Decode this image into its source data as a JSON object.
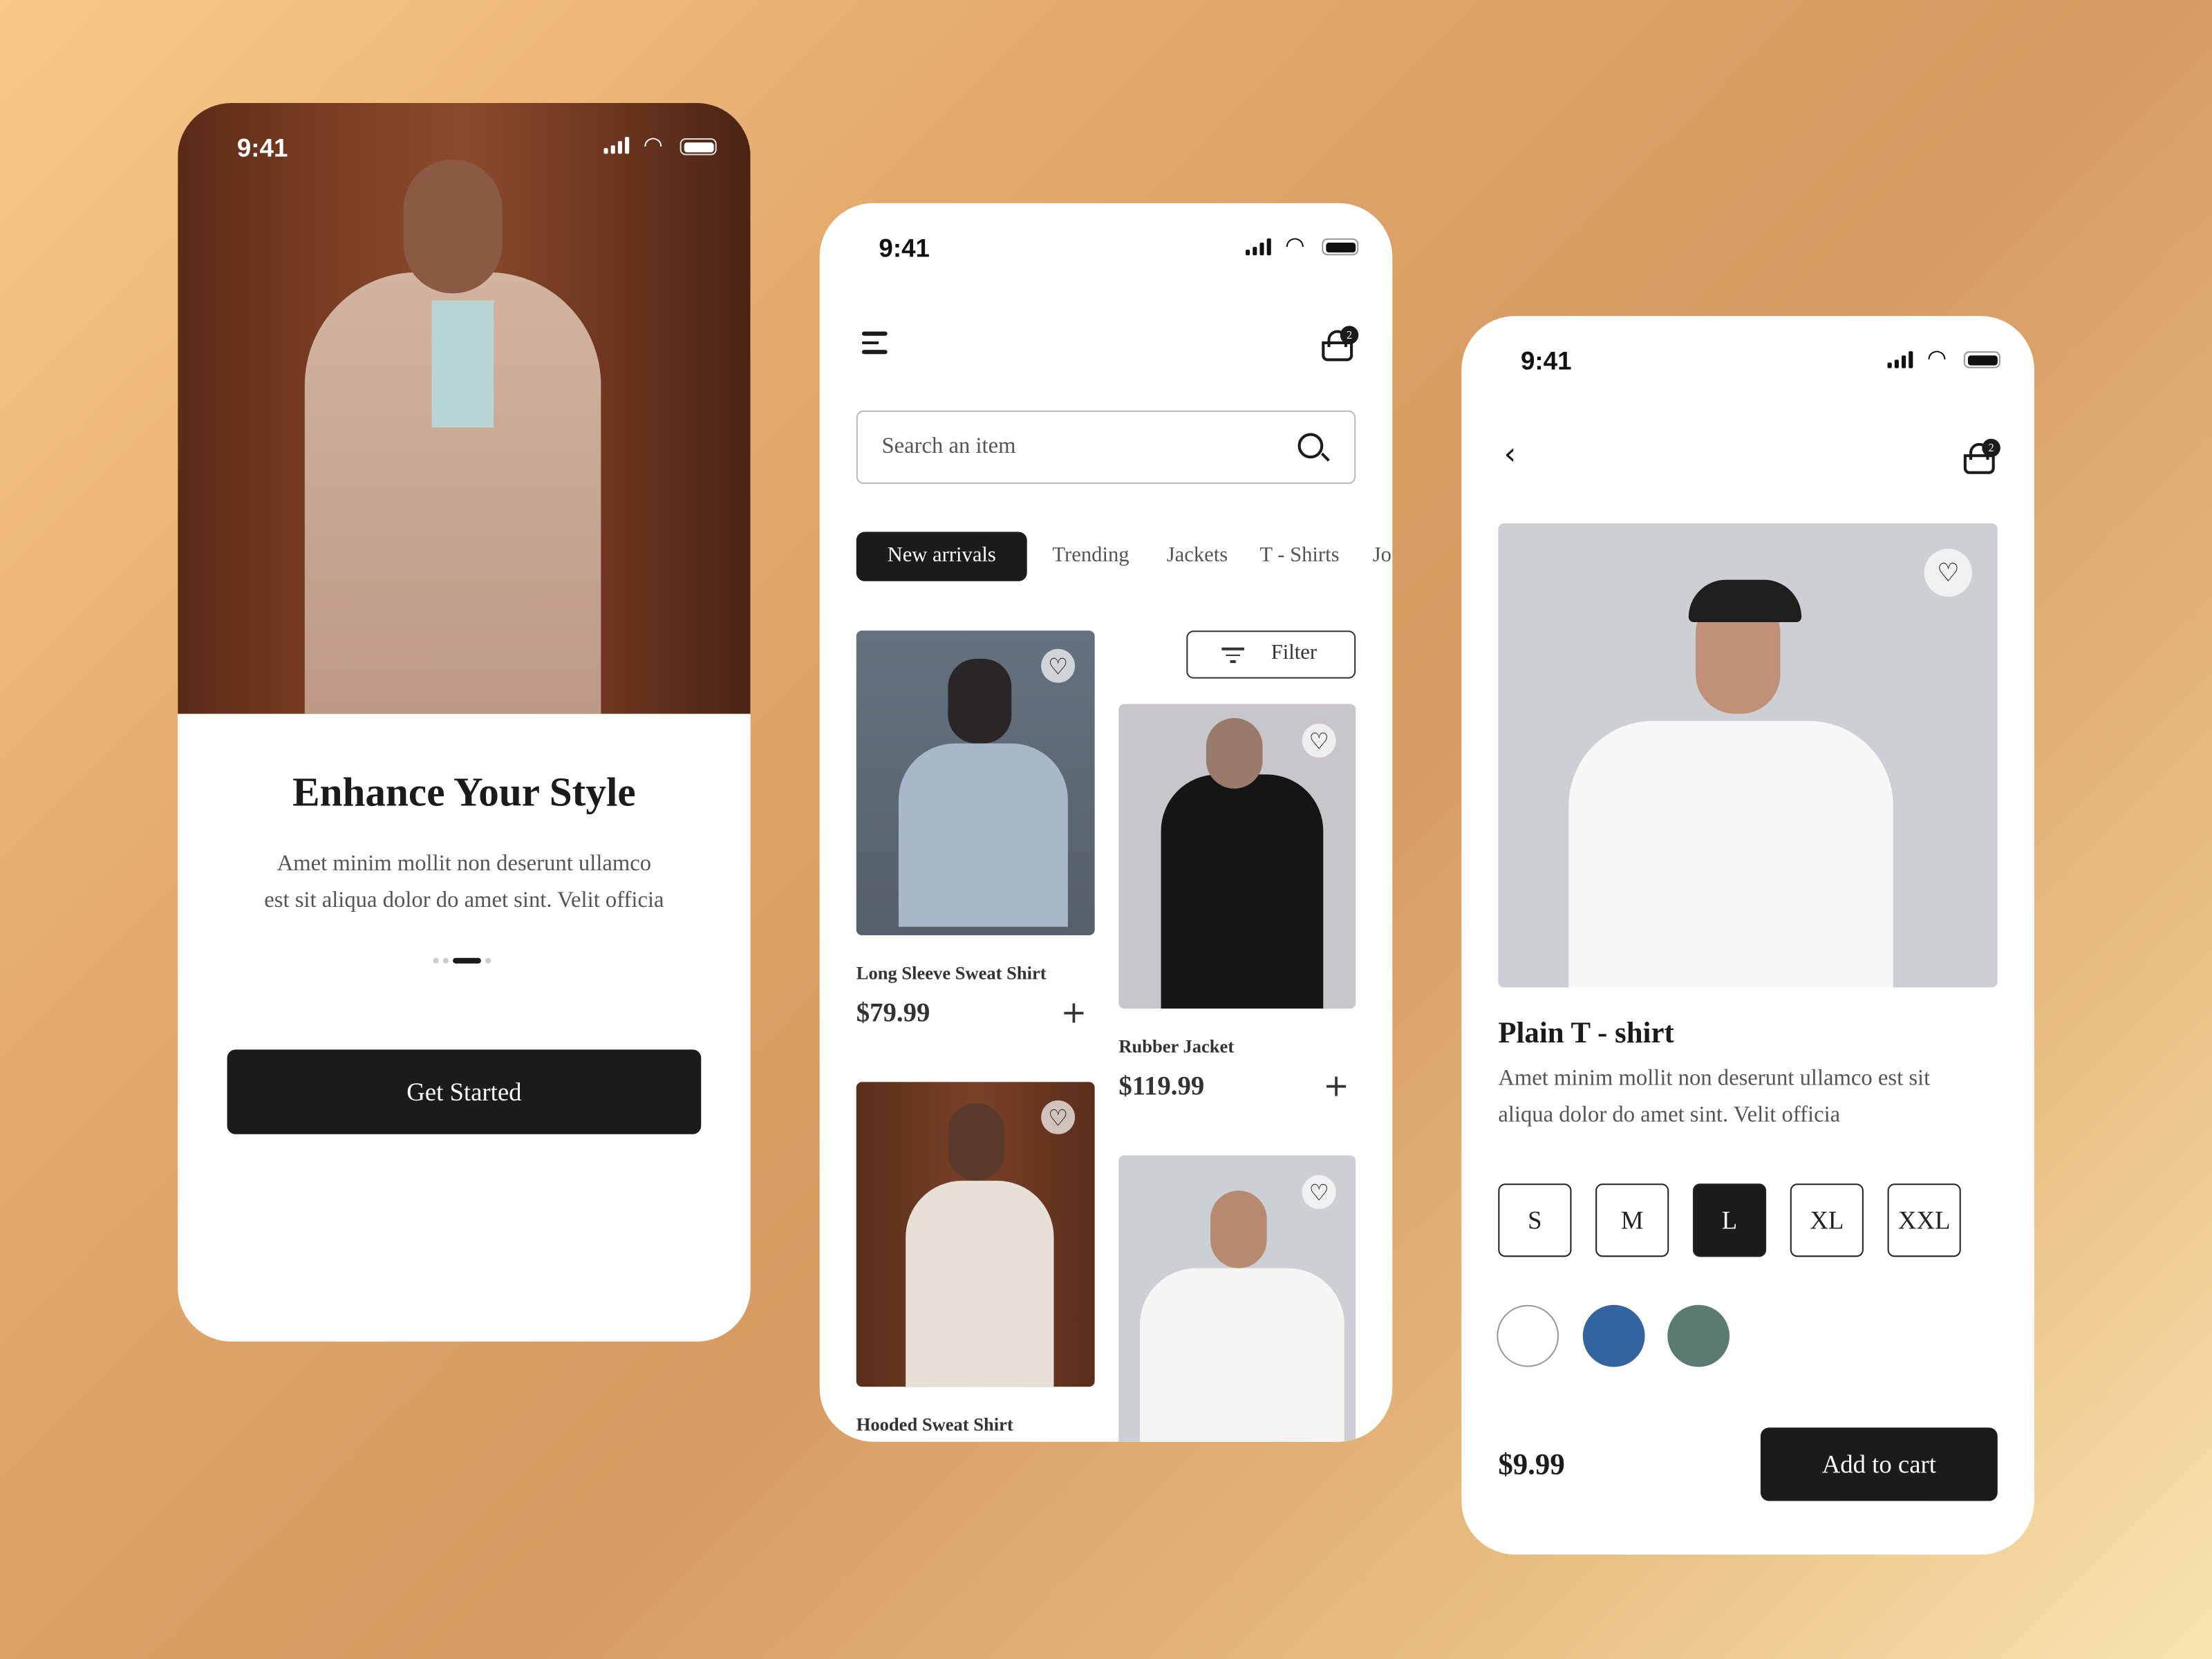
{
  "status_bar": {
    "time": "9:41"
  },
  "onboarding": {
    "title": "Enhance Your Style",
    "body_line1": "Amet minim mollit non deserunt ullamco",
    "body_line2": "est sit aliqua dolor do amet sint. Velit officia",
    "page_indicator": {
      "total": 4,
      "active": 2
    },
    "cta": "Get Started"
  },
  "catalog": {
    "cart_count": "2",
    "search_placeholder": "Search an item",
    "tabs": [
      {
        "label": "New arrivals",
        "active": true
      },
      {
        "label": "Trending"
      },
      {
        "label": "Jackets"
      },
      {
        "label": "T - Shirts"
      },
      {
        "label": "Jo"
      }
    ],
    "filter_label": "Filter",
    "products": [
      {
        "name": "Long Sleeve Sweat Shirt",
        "price": "$79.99"
      },
      {
        "name": "Rubber Jacket",
        "price": "$119.99"
      },
      {
        "name": "Hooded Sweat Shirt"
      },
      {
        "name": ""
      }
    ]
  },
  "detail": {
    "cart_count": "2",
    "title": "Plain T - shirt",
    "desc_line1": "Amet minim mollit non deserunt ullamco est sit",
    "desc_line2": "aliqua dolor do amet sint. Velit officia",
    "sizes": [
      {
        "label": "S"
      },
      {
        "label": "M"
      },
      {
        "label": "L",
        "selected": true
      },
      {
        "label": "XL"
      },
      {
        "label": "XXL"
      }
    ],
    "colors": [
      "#ffffff",
      "#3565a0",
      "#5a7a72"
    ],
    "price": "$9.99",
    "cta": "Add to cart"
  }
}
